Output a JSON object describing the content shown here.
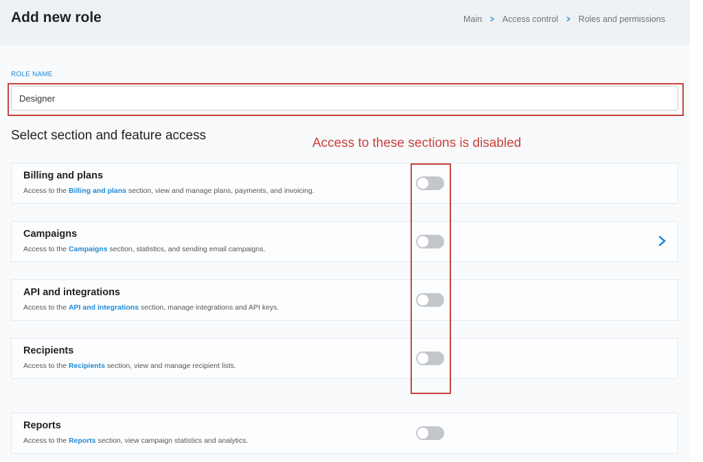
{
  "header": {
    "title": "Add new role",
    "breadcrumb": [
      "Main",
      "Access control",
      "Roles and permissions"
    ]
  },
  "role": {
    "label": "ROLE NAME",
    "value": "Designer"
  },
  "section_heading": "Select section and feature access",
  "annotation": "Access to these sections is disabled",
  "sections": [
    {
      "title": "Billing and plans",
      "desc_prefix": "Access to the ",
      "desc_link": "Billing and plans",
      "desc_suffix": " section, view and manage plans, payments, and invoicing.",
      "enabled": false
    },
    {
      "title": "Campaigns",
      "desc_prefix": "Access to the ",
      "desc_link": "Campaigns",
      "desc_suffix": " section, statistics, and sending email campaigns.",
      "enabled": false,
      "expandable": true
    },
    {
      "title": "API and integrations",
      "desc_prefix": "Access to the ",
      "desc_link": "API and integrations",
      "desc_suffix": " section, manage integrations and API keys.",
      "enabled": false
    },
    {
      "title": "Recipients",
      "desc_prefix": "Access to the ",
      "desc_link": "Recipients",
      "desc_suffix": " section, view and manage recipient lists.",
      "enabled": false
    },
    {
      "title": "Reports",
      "desc_prefix": "Access to the ",
      "desc_link": "Reports",
      "desc_suffix": " section, view campaign statistics and analytics.",
      "enabled": false
    }
  ],
  "colors": {
    "accent": "#1f8ad6",
    "annotation": "#c9413a",
    "toggle_off": "#c3c7cb"
  },
  "icons": {
    "breadcrumb_separator": "chevron-right-icon",
    "expand": "chevron-right-icon"
  }
}
